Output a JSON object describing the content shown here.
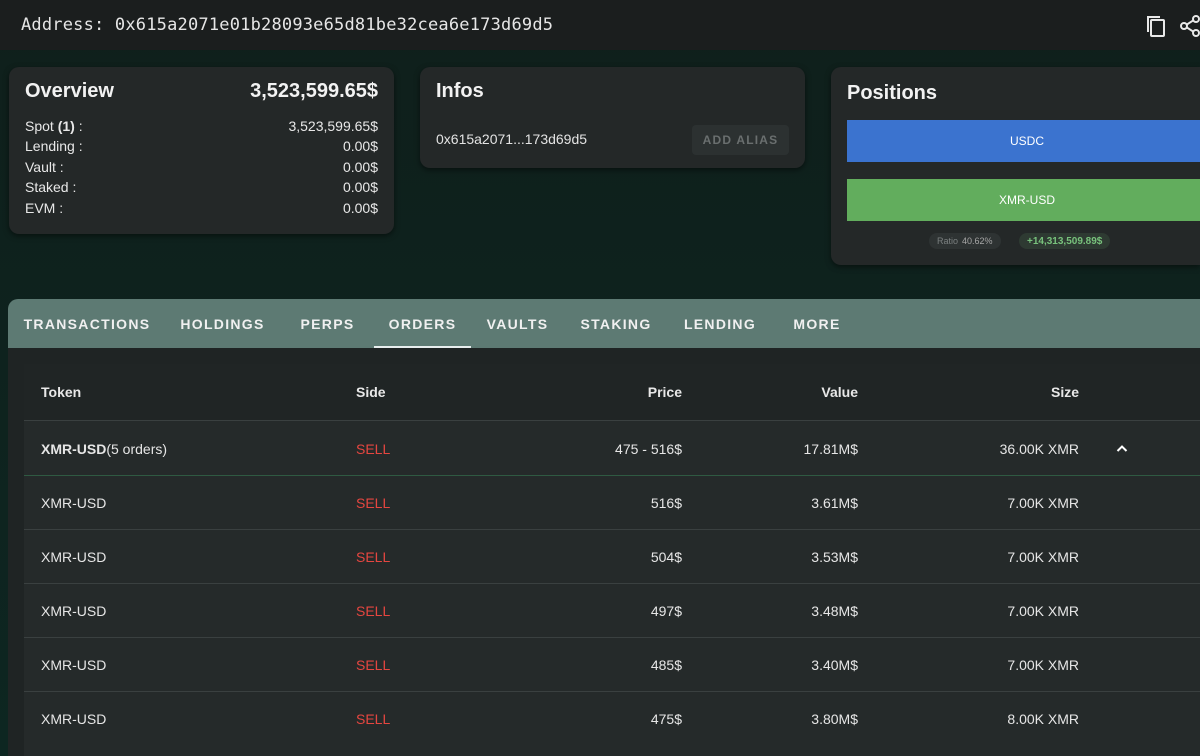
{
  "address_bar": {
    "label": "Address:",
    "address": "0x615a2071e01b28093e65d81be32cea6e173d69d5",
    "copy_icon": "copy-icon",
    "share_icon": "share-icon"
  },
  "overview": {
    "title": "Overview",
    "total": "3,523,599.65$",
    "rows": [
      {
        "label_pre": "Spot ",
        "label_bold": "(1)",
        "label_post": " :",
        "value": "3,523,599.65$"
      },
      {
        "label": "Lending :",
        "value": "0.00$"
      },
      {
        "label": "Vault :",
        "value": "0.00$"
      },
      {
        "label": "Staked :",
        "value": "0.00$"
      },
      {
        "label": "EVM :",
        "value": "0.00$"
      }
    ]
  },
  "infos": {
    "title": "Infos",
    "short_address": "0x615a2071...173d69d5",
    "add_alias_label": "ADD ALIAS"
  },
  "positions": {
    "title": "Positions",
    "bars": [
      {
        "label": "USDC",
        "color": "#3b73cf"
      },
      {
        "label": "XMR-USD",
        "color": "#62ad5d"
      }
    ],
    "ratio_label": "Ratio",
    "ratio_value": "40.62%",
    "pnl": "+14,313,509.89$"
  },
  "tabs": [
    {
      "label": "TRANSACTIONS"
    },
    {
      "label": "HOLDINGS"
    },
    {
      "label": "PERPS"
    },
    {
      "label": "ORDERS",
      "active": true
    },
    {
      "label": "VAULTS"
    },
    {
      "label": "STAKING"
    },
    {
      "label": "LENDING"
    },
    {
      "label": "MORE"
    }
  ],
  "orders_table": {
    "columns": {
      "token": "Token",
      "side": "Side",
      "price": "Price",
      "value": "Value",
      "size": "Size"
    },
    "group": {
      "token": "XMR-USD",
      "suffix": "(5 orders)",
      "side": "SELL",
      "price": "475 - 516$",
      "value": "17.81M$",
      "size": "36.00K XMR",
      "toggle_icon": "chevron-up-icon"
    },
    "rows": [
      {
        "token": "XMR-USD",
        "side": "SELL",
        "price": "516$",
        "value": "3.61M$",
        "size": "7.00K XMR"
      },
      {
        "token": "XMR-USD",
        "side": "SELL",
        "price": "504$",
        "value": "3.53M$",
        "size": "7.00K XMR"
      },
      {
        "token": "XMR-USD",
        "side": "SELL",
        "price": "497$",
        "value": "3.48M$",
        "size": "7.00K XMR"
      },
      {
        "token": "XMR-USD",
        "side": "SELL",
        "price": "485$",
        "value": "3.40M$",
        "size": "7.00K XMR"
      },
      {
        "token": "XMR-USD",
        "side": "SELL",
        "price": "475$",
        "value": "3.80M$",
        "size": "8.00K XMR"
      }
    ]
  },
  "colors": {
    "sell": "#e54640",
    "tab_bar": "#5d7a73",
    "card": "#242828"
  }
}
